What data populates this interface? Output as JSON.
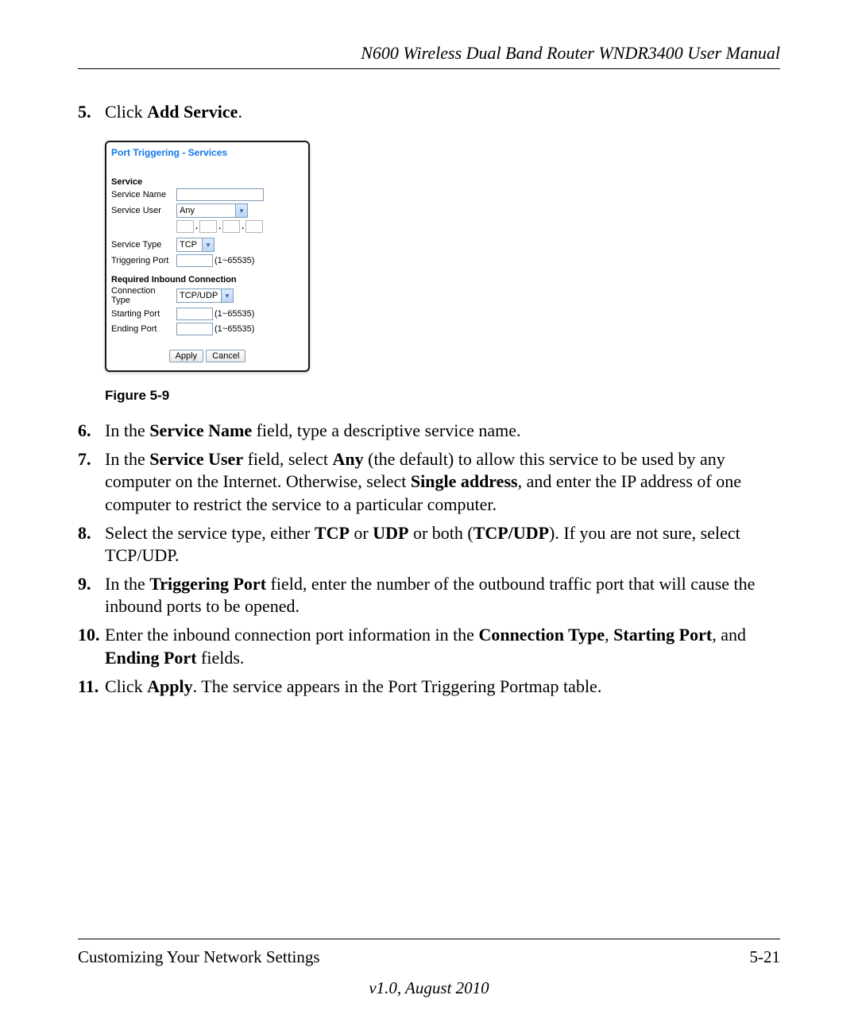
{
  "header": {
    "title": "N600 Wireless Dual Band Router WNDR3400 User Manual"
  },
  "steps": {
    "s5": {
      "num": "5.",
      "pre": "Click ",
      "bold": "Add Service",
      "post": "."
    },
    "s6": {
      "num": "6.",
      "t1": "In the ",
      "b1": "Service Name",
      "t2": " field, type a descriptive service name."
    },
    "s7": {
      "num": "7.",
      "t1": "In the ",
      "b1": "Service User",
      "t2": " field, select ",
      "b2": "Any",
      "t3": " (the default) to allow this service to be used by any computer on the Internet. Otherwise, select ",
      "b3": "Single address",
      "t4": ", and enter the IP address of one computer to restrict the service to a particular computer."
    },
    "s8": {
      "num": "8.",
      "t1": "Select the service type, either ",
      "b1": "TCP",
      "t2": " or ",
      "b2": "UDP",
      "t3": " or both (",
      "b3": "TCP/UDP",
      "t4": "). If you are not sure, select TCP/UDP."
    },
    "s9": {
      "num": "9.",
      "t1": "In the ",
      "b1": "Triggering Port",
      "t2": " field, enter the number of the outbound traffic port that will cause the inbound ports to be opened."
    },
    "s10": {
      "num": "10.",
      "t1": "Enter the inbound connection port information in the ",
      "b1": "Connection Type",
      "t2": ", ",
      "b2": "Starting Port",
      "t3": ", and ",
      "b3": "Ending Port",
      "t4": " fields."
    },
    "s11": {
      "num": "11.",
      "t1": "Click ",
      "b1": "Apply",
      "t2": ". The service appears in the Port Triggering Portmap table."
    }
  },
  "screenshot": {
    "title": "Port Triggering - Services",
    "section_service": "Service",
    "labels": {
      "service_name": "Service Name",
      "service_user": "Service User",
      "service_type": "Service Type",
      "trig_port": "Triggering Port"
    },
    "values": {
      "service_user": "Any",
      "service_type": "TCP",
      "conn_type": "TCP/UDP"
    },
    "range": "(1~65535)",
    "section_inbound": "Required Inbound Connection",
    "labels2": {
      "conn_type": "Connection Type",
      "starting_port": "Starting Port",
      "ending_port": "Ending Port"
    },
    "buttons": {
      "apply": "Apply",
      "cancel": "Cancel"
    }
  },
  "figure_caption": "Figure 5-9",
  "footer": {
    "left": "Customizing Your Network Settings",
    "right": "5-21",
    "version": "v1.0, August 2010"
  }
}
